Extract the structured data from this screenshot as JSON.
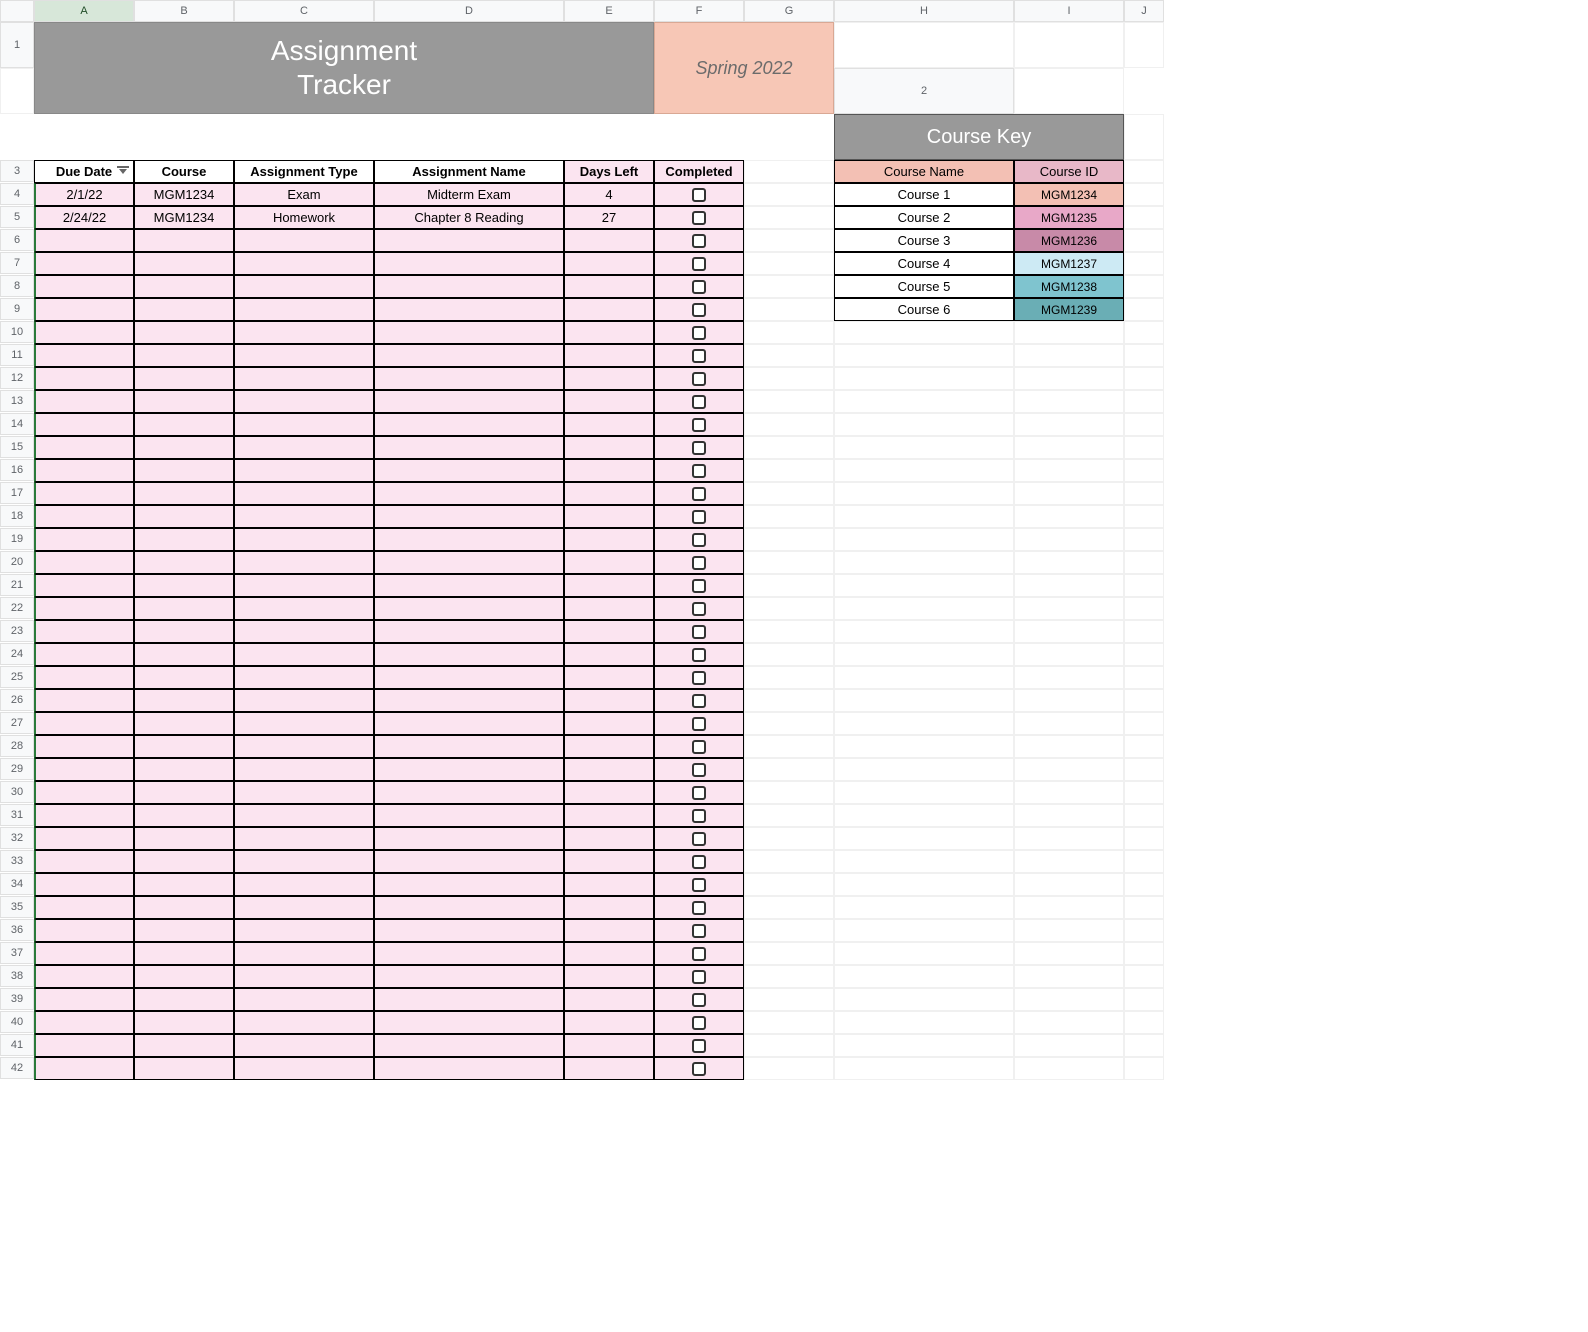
{
  "columns": [
    "A",
    "B",
    "C",
    "D",
    "E",
    "F",
    "G",
    "H",
    "I",
    "J"
  ],
  "title": {
    "line1": "Assignment",
    "line2": "Tracker"
  },
  "semester": "Spring 2022",
  "table_headers": {
    "due_date": "Due Date",
    "course": "Course",
    "assignment_type": "Assignment Type",
    "assignment_name": "Assignment Name",
    "days_left": "Days Left",
    "completed": "Completed"
  },
  "assignments": [
    {
      "due_date": "2/1/22",
      "course": "MGM1234",
      "type": "Exam",
      "name": "Midterm Exam",
      "days_left": "4",
      "completed": false
    },
    {
      "due_date": "2/24/22",
      "course": "MGM1234",
      "type": "Homework",
      "name": "Chapter 8 Reading",
      "days_left": "27",
      "completed": false
    }
  ],
  "blank_rows": 37,
  "course_key": {
    "title": "Course Key",
    "headers": {
      "name": "Course Name",
      "id": "Course ID"
    },
    "rows": [
      {
        "name": "Course 1",
        "id": "MGM1234",
        "color": "#f3c0b4"
      },
      {
        "name": "Course 2",
        "id": "MGM1235",
        "color": "#e8a8c8"
      },
      {
        "name": "Course 3",
        "id": "MGM1236",
        "color": "#c88aa8"
      },
      {
        "name": "Course 4",
        "id": "MGM1237",
        "color": "#cdeaf4"
      },
      {
        "name": "Course 5",
        "id": "MGM1238",
        "color": "#7fc4cf"
      },
      {
        "name": "Course 6",
        "id": "MGM1239",
        "color": "#6aaeb5"
      }
    ]
  }
}
